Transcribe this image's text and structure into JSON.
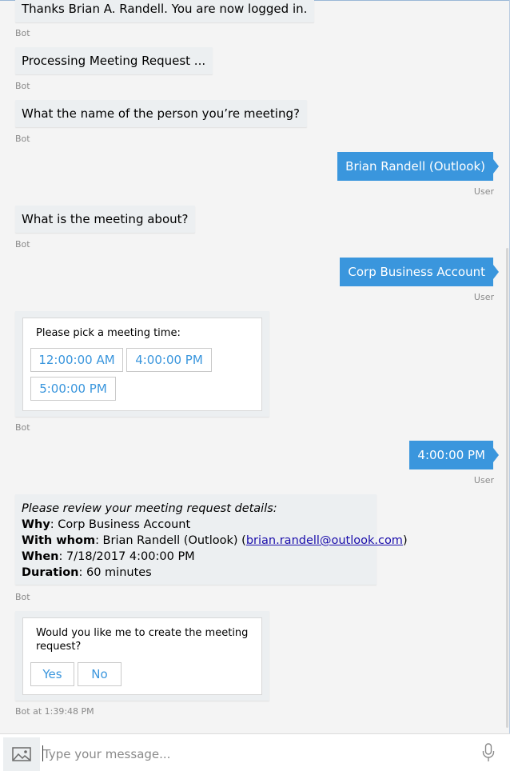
{
  "messages": {
    "m1": {
      "text": "Thanks Brian A. Randell. You are now logged in.",
      "meta": "Bot"
    },
    "m2": {
      "text": "Processing Meeting Request ...",
      "meta": "Bot"
    },
    "m3": {
      "text": "What the name of the person you’re meeting?",
      "meta": "Bot"
    },
    "u1": {
      "text": "Brian Randell (Outlook)",
      "meta": "User"
    },
    "m4": {
      "text": "What is the meeting about?",
      "meta": "Bot"
    },
    "u2": {
      "text": "Corp Business Account",
      "meta": "User"
    },
    "card1": {
      "title": "Please pick a meeting time:",
      "options": [
        "12:00:00 AM",
        "4:00:00 PM",
        "5:00:00 PM"
      ],
      "meta": "Bot"
    },
    "u3": {
      "text": "4:00:00 PM",
      "meta": "User"
    },
    "review": {
      "lead": "Please review your meeting request details:",
      "why_label": "Why",
      "why_value": ": Corp Business Account",
      "with_label": "With whom",
      "with_value": ": Brian Randell (Outlook) (",
      "with_email": "brian.randell@outlook.com",
      "with_close": ")",
      "when_label": "When",
      "when_value": ": 7/18/2017 4:00:00 PM",
      "duration_label": "Duration",
      "duration_value": ": 60 minutes",
      "meta": "Bot"
    },
    "card2": {
      "title": "Would you like me to create the meeting request?",
      "options": [
        "Yes",
        "No"
      ],
      "meta": "Bot at 1:39:48 PM"
    }
  },
  "input": {
    "placeholder": "Type your message..."
  },
  "icons": {
    "upload": "image-upload-icon",
    "mic": "microphone-icon"
  },
  "colors": {
    "user_bubble": "#3a96dd",
    "bot_bubble": "#eceff1",
    "link": "#1a0dab"
  }
}
